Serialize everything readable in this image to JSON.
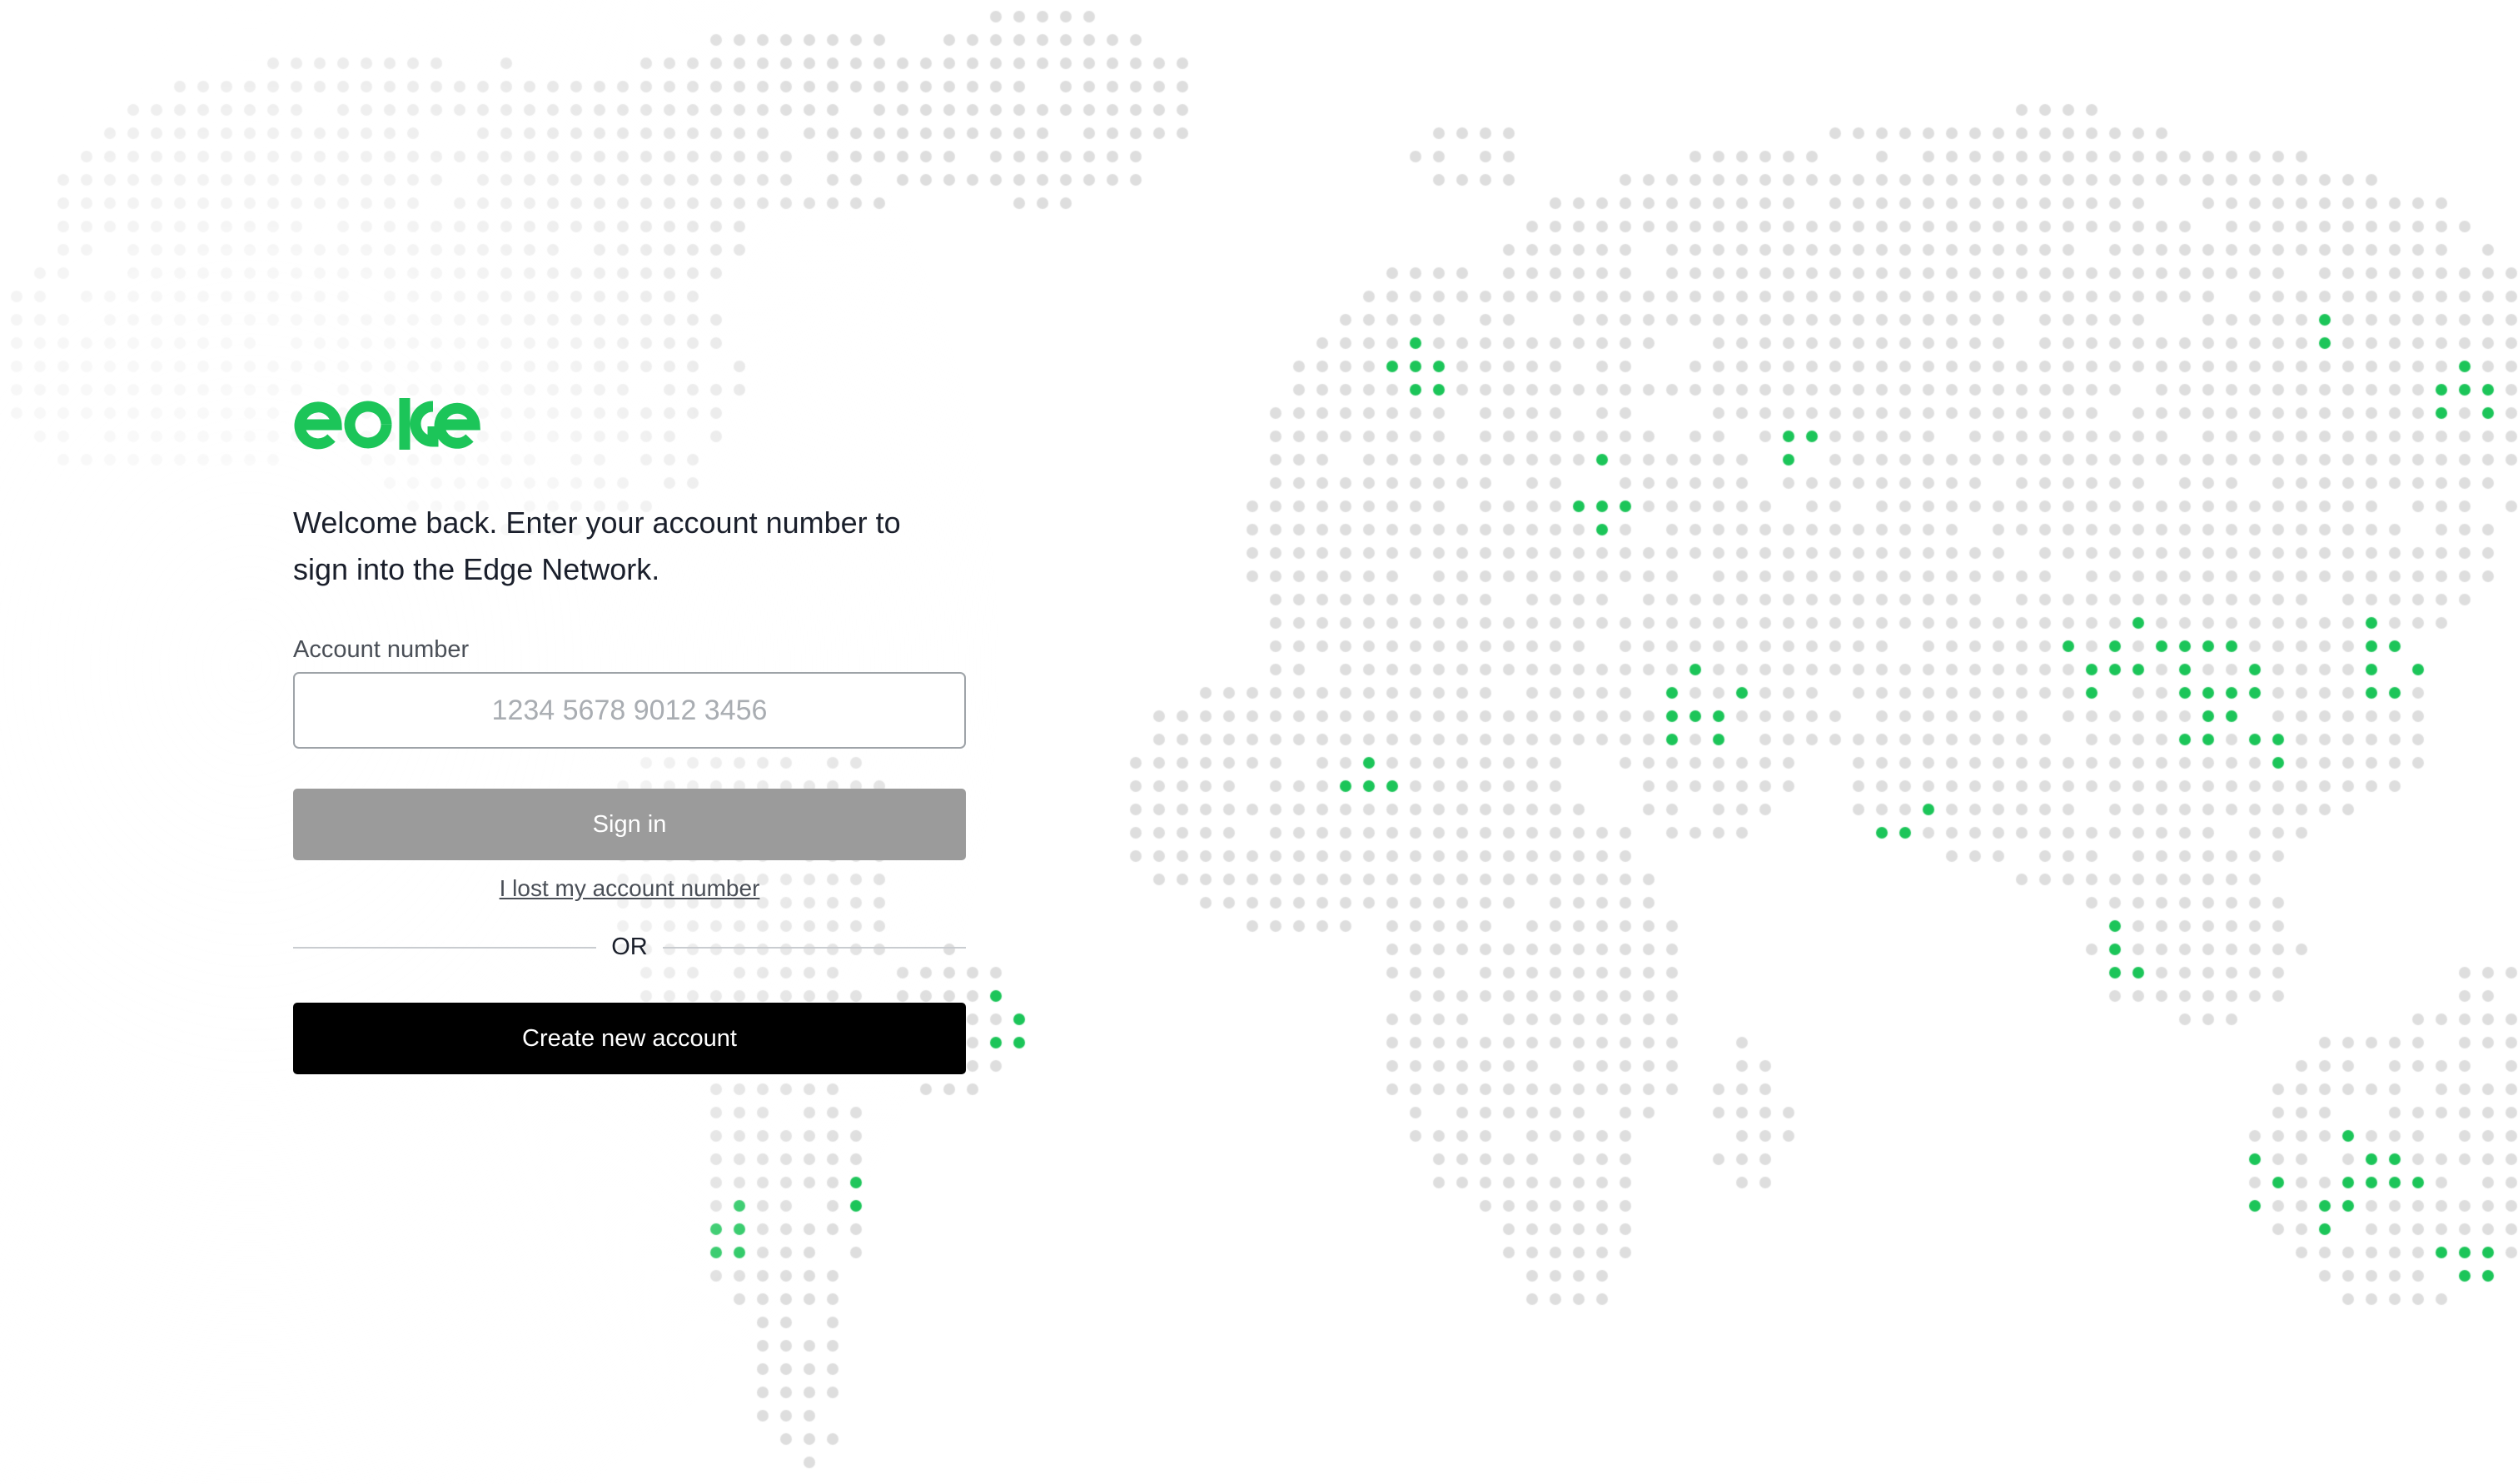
{
  "brand": {
    "name": "edge",
    "accent_color": "#1cc559"
  },
  "login": {
    "welcome_text": "Welcome back. Enter your account number to sign into the Edge Network.",
    "account_label": "Account number",
    "account_placeholder": "1234 5678 9012 3456",
    "account_value": "",
    "signin_label": "Sign in",
    "lost_link_label": "I lost my account number",
    "divider_label": "OR",
    "create_label": "Create new account"
  },
  "map": {
    "dot_color": "#dedede",
    "active_dot_color": "#1cc559"
  }
}
